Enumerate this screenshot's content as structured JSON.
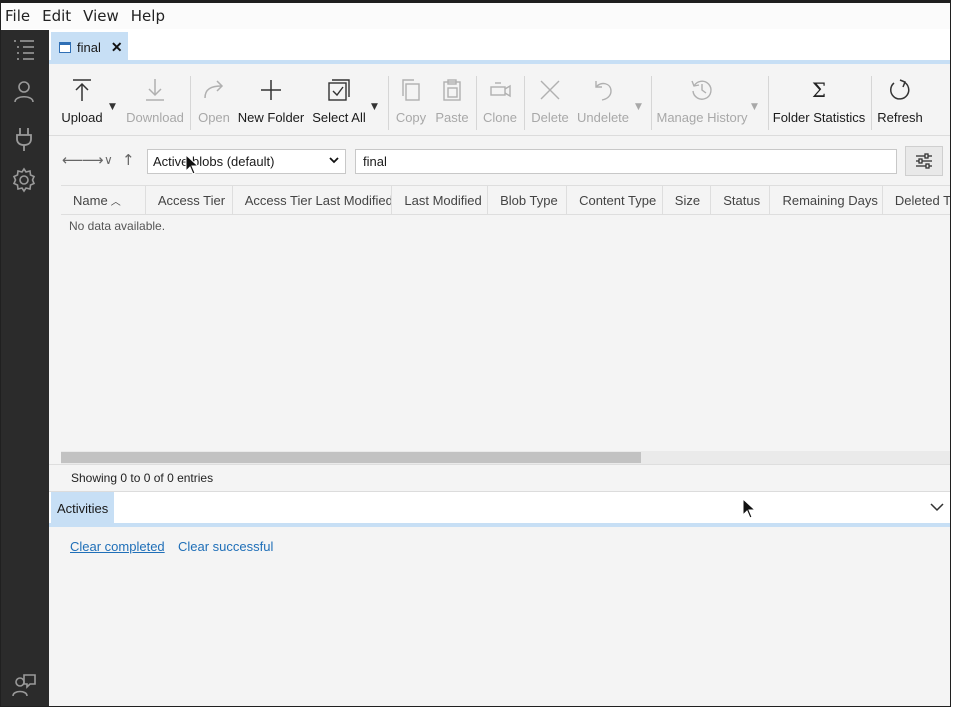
{
  "menubar": {
    "items": [
      "File",
      "Edit",
      "View",
      "Help"
    ]
  },
  "activity_bar": {
    "icons": [
      "explorer-icon",
      "account-icon",
      "plug-icon",
      "settings-icon",
      "feedback-icon"
    ]
  },
  "tabs": [
    {
      "label": "final",
      "close": "✕"
    }
  ],
  "toolbar": {
    "upload": "Upload",
    "download": "Download",
    "open": "Open",
    "new_folder": "New Folder",
    "select_all": "Select All",
    "copy": "Copy",
    "paste": "Paste",
    "clone": "Clone",
    "delete": "Delete",
    "undelete": "Undelete",
    "manage_history": "Manage History",
    "folder_statistics": "Folder Statistics",
    "refresh": "Refresh",
    "sigma": "Σ"
  },
  "nav": {
    "view_selected": "Active blobs (default)",
    "path_value": "final"
  },
  "grid": {
    "columns": [
      "Name",
      "Access Tier",
      "Access Tier Last Modified",
      "Last Modified",
      "Blob Type",
      "Content Type",
      "Size",
      "Status",
      "Remaining Days",
      "Deleted Time"
    ],
    "sort_indicator": "^",
    "empty_text": "No data available.",
    "status": "Showing 0 to 0 of 0 entries"
  },
  "activities": {
    "tab_label": "Activities",
    "clear_completed": "Clear completed",
    "clear_successful": "Clear successful"
  },
  "colors": {
    "accent": "#c7dff5",
    "activity_bar": "#2b2b2b",
    "link": "#1f6fb8"
  }
}
